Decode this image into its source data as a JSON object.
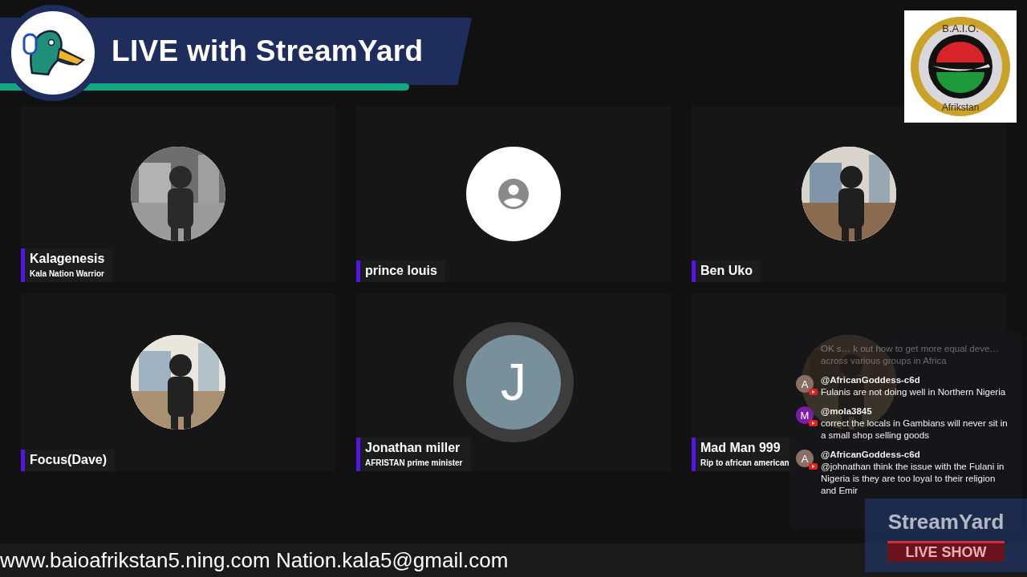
{
  "banner": {
    "title": "LIVE with StreamYard"
  },
  "logo": {
    "top": "B.A.I.O.",
    "bottom": "Afrikstan"
  },
  "participants": [
    {
      "name": "Kalagenesis",
      "subtitle": "Kala Nation Warrior"
    },
    {
      "name": "prince louis",
      "avatar": {
        "kind": "placeholder"
      }
    },
    {
      "name": "Ben Uko"
    },
    {
      "name": "Focus(Dave)"
    },
    {
      "name": "Jonathan miller",
      "subtitle": "AFRISTAN prime minister",
      "avatar": {
        "kind": "initial",
        "initial": "J"
      }
    },
    {
      "name": "Mad Man 999",
      "subtitle": "Rip to african american"
    }
  ],
  "chat": [
    {
      "text": "OK s… k out how to get more equal deve… across various groups in Africa",
      "faded": true
    },
    {
      "author": "@AfricanGoddess-c6d",
      "initial": "A",
      "color": "#8a6f66",
      "text": "Fulanis are not doing well in Northern Nigeria",
      "faded": false
    },
    {
      "author": "@mola3845",
      "initial": "M",
      "color": "#7b1fa2",
      "text": "correct the locals in Gambians will never sit in a small shop selling goods",
      "faded": false
    },
    {
      "author": "@AfricanGoddess-c6d",
      "initial": "A",
      "color": "#8a6f66",
      "text": "@johnathan think the issue with the Fulani in Nigeria is they are too loyal to their religion and Emir",
      "faded": false
    }
  ],
  "ticker": "www.baioafrikstan5.ning.com Nation.kala5@gmail.com",
  "brand": {
    "name": "StreamYard",
    "tag": "LIVE SHOW"
  }
}
